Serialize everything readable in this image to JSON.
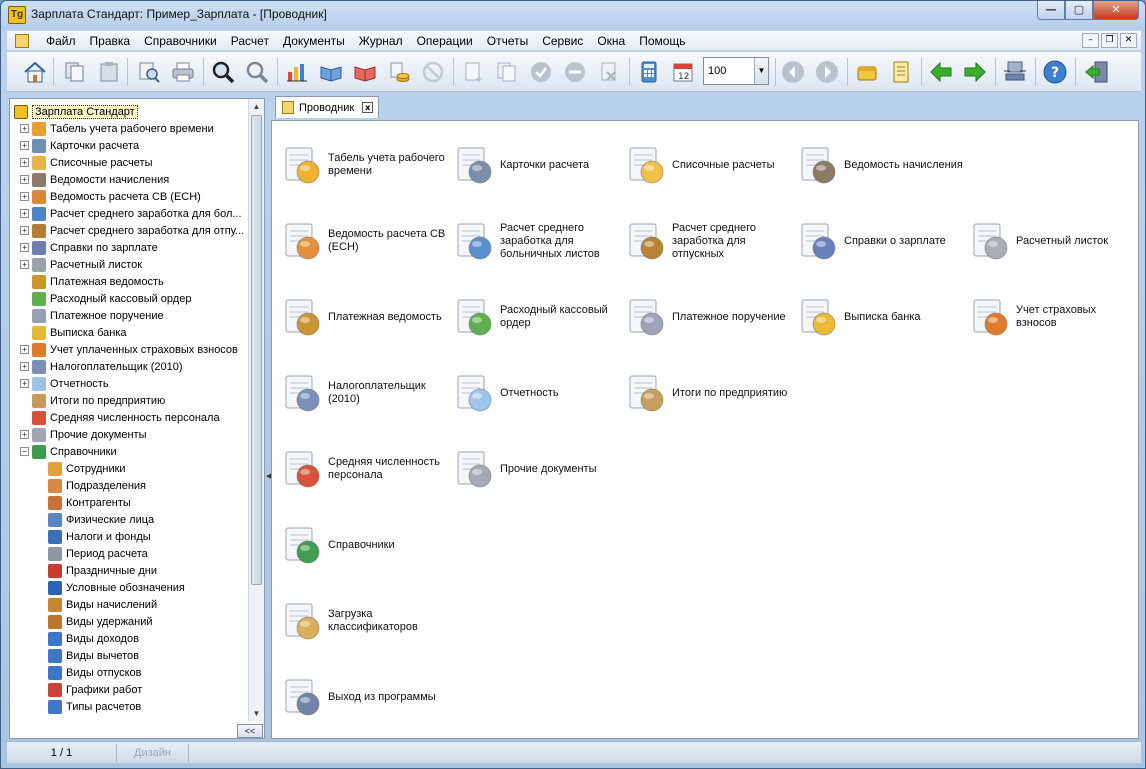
{
  "window": {
    "title": "Зарплата Стандарт: Пример_Зарплата - [Проводник]",
    "app_icon_text": "Tg",
    "controls": {
      "minimize": "—",
      "maximize": "▢",
      "close": "✕"
    }
  },
  "menu": {
    "items": [
      "Файл",
      "Правка",
      "Справочники",
      "Расчет",
      "Документы",
      "Журнал",
      "Операции",
      "Отчеты",
      "Сервис",
      "Окна",
      "Помощь"
    ],
    "mdi": {
      "minimize": "–",
      "restore": "❐",
      "close": "✕"
    }
  },
  "toolbar": {
    "zoom_value": "100",
    "dropdown_arrow": "▼"
  },
  "tree": {
    "root": "Зарплата Стандарт",
    "items": [
      {
        "label": "Табель учета рабочего времени",
        "exp": "+",
        "level": 0,
        "color": "#e8a030"
      },
      {
        "label": "Карточки расчета",
        "exp": "+",
        "level": 0,
        "color": "#6f8fb5"
      },
      {
        "label": "Списочные расчеты",
        "exp": "+",
        "level": 0,
        "color": "#e6b44a"
      },
      {
        "label": "Ведомости начисления",
        "exp": "+",
        "level": 0,
        "color": "#8c7b6a"
      },
      {
        "label": "Ведомость расчета СВ (ЕСН)",
        "exp": "+",
        "level": 0,
        "color": "#d9883a"
      },
      {
        "label": "Расчет среднего заработка для бол...",
        "exp": "+",
        "level": 0,
        "color": "#4f84c4"
      },
      {
        "label": "Расчет среднего заработка для отпу...",
        "exp": "+",
        "level": 0,
        "color": "#b07d35"
      },
      {
        "label": "Справки по зарплате",
        "exp": "+",
        "level": 0,
        "color": "#6a7fb0"
      },
      {
        "label": "Расчетный листок",
        "exp": "+",
        "level": 0,
        "color": "#9aa3ad"
      },
      {
        "label": "Платежная ведомость",
        "exp": "",
        "level": 0,
        "color": "#c9952d"
      },
      {
        "label": "Расходный кассовый ордер",
        "exp": "",
        "level": 0,
        "color": "#5fae4f"
      },
      {
        "label": "Платежное поручение",
        "exp": "",
        "level": 0,
        "color": "#9aa0b4"
      },
      {
        "label": "Выписка банка",
        "exp": "",
        "level": 0,
        "color": "#e6b933"
      },
      {
        "label": "Учет уплаченных страховых взносов",
        "exp": "+",
        "level": 0,
        "color": "#e07a2a"
      },
      {
        "label": "Налогоплательщик (2010)",
        "exp": "+",
        "level": 0,
        "color": "#7b8fb5"
      },
      {
        "label": "Отчетность",
        "exp": "+",
        "level": 0,
        "color": "#9ec1e6"
      },
      {
        "label": "Итоги по предприятию",
        "exp": "",
        "level": 0,
        "color": "#c89a5a"
      },
      {
        "label": "Средняя численность персонала",
        "exp": "",
        "level": 0,
        "color": "#d9503a"
      },
      {
        "label": "Прочие документы",
        "exp": "+",
        "level": 0,
        "color": "#a0a6b3"
      },
      {
        "label": "Справочники",
        "exp": "−",
        "level": 0,
        "color": "#3d9a4e"
      },
      {
        "label": "Сотрудники",
        "exp": "",
        "level": 1,
        "color": "#e2a137"
      },
      {
        "label": "Подразделения",
        "exp": "",
        "level": 1,
        "color": "#d78a3f"
      },
      {
        "label": "Контрагенты",
        "exp": "",
        "level": 1,
        "color": "#c9733a"
      },
      {
        "label": "Физические лица",
        "exp": "",
        "level": 1,
        "color": "#5a83c1"
      },
      {
        "label": "Налоги и фонды",
        "exp": "",
        "level": 1,
        "color": "#3c6fb3"
      },
      {
        "label": "Период расчета",
        "exp": "",
        "level": 1,
        "color": "#8d97a6"
      },
      {
        "label": "Праздничные дни",
        "exp": "",
        "level": 1,
        "color": "#c63c2e"
      },
      {
        "label": "Условные обозначения",
        "exp": "",
        "level": 1,
        "color": "#2b64b5"
      },
      {
        "label": "Виды начислений",
        "exp": "",
        "level": 1,
        "color": "#c5872f"
      },
      {
        "label": "Виды удержаний",
        "exp": "",
        "level": 1,
        "color": "#b9762a"
      },
      {
        "label": "Виды доходов",
        "exp": "",
        "level": 1,
        "color": "#3f76c7"
      },
      {
        "label": "Виды вычетов",
        "exp": "",
        "level": 1,
        "color": "#3f76c7"
      },
      {
        "label": "Виды отпусков",
        "exp": "",
        "level": 1,
        "color": "#3f76c7"
      },
      {
        "label": "Графики работ",
        "exp": "",
        "level": 1,
        "color": "#c94538"
      },
      {
        "label": "Типы расчетов",
        "exp": "",
        "level": 1,
        "color": "#3f76c7"
      }
    ],
    "collapse_label": "<<",
    "scroll_up": "▲",
    "scroll_down": "▼"
  },
  "tab": {
    "label": "Проводник",
    "close": "x"
  },
  "explorer": {
    "items": [
      {
        "id": "timesheet",
        "label": "Табель учета рабочего времени",
        "col": 0,
        "row": 0,
        "color": "#f0b030",
        "icon": "timesheet-icon"
      },
      {
        "id": "calc-cards",
        "label": "Карточки расчета",
        "col": 1,
        "row": 0,
        "color": "#7d8fa8",
        "icon": "calc-cards-icon"
      },
      {
        "id": "list-calc",
        "label": "Списочные расчеты",
        "col": 2,
        "row": 0,
        "color": "#f2c04a",
        "icon": "list-calc-icon"
      },
      {
        "id": "accrual-sheet",
        "label": "Ведомость начисления",
        "col": 3,
        "row": 0,
        "color": "#8a7a66",
        "icon": "accrual-sheet-icon"
      },
      {
        "id": "sv-sheet",
        "label": "Ведомость расчета СВ (ЕСН)",
        "col": 0,
        "row": 1,
        "color": "#e2903c",
        "icon": "sv-sheet-icon"
      },
      {
        "id": "sick-avg",
        "label": "Расчет среднего заработка для больничных листов",
        "col": 1,
        "row": 1,
        "color": "#5a8fd0",
        "icon": "sick-avg-icon"
      },
      {
        "id": "vacation-avg",
        "label": "Расчет среднего заработка для отпускных",
        "col": 2,
        "row": 1,
        "color": "#b98535",
        "icon": "vacation-avg-icon"
      },
      {
        "id": "salary-cert",
        "label": "Справки о зарплате",
        "col": 3,
        "row": 1,
        "color": "#6a80b8",
        "icon": "salary-cert-icon"
      },
      {
        "id": "payslip",
        "label": "Расчетный листок",
        "col": 4,
        "row": 1,
        "color": "#a7aeb8",
        "icon": "payslip-icon"
      },
      {
        "id": "pay-sheet",
        "label": "Платежная ведомость",
        "col": 0,
        "row": 2,
        "color": "#c99530",
        "icon": "money-bag-icon"
      },
      {
        "id": "cash-order",
        "label": "Расходный кассовый ордер",
        "col": 1,
        "row": 2,
        "color": "#5cb050",
        "icon": "cash-order-icon"
      },
      {
        "id": "pay-order",
        "label": "Платежное поручение",
        "col": 2,
        "row": 2,
        "color": "#9ea4b8",
        "icon": "pay-order-icon"
      },
      {
        "id": "bank-statement",
        "label": "Выписка банка",
        "col": 3,
        "row": 2,
        "color": "#e8ba35",
        "icon": "bank-statement-icon"
      },
      {
        "id": "insurance",
        "label": "Учет страховых взносов",
        "col": 4,
        "row": 2,
        "color": "#e27a2c",
        "icon": "insurance-icon"
      },
      {
        "id": "taxpayer",
        "label": "Налогоплательщик (2010)",
        "col": 0,
        "row": 3,
        "color": "#7b90b8",
        "icon": "taxpayer-icon"
      },
      {
        "id": "reporting",
        "label": "Отчетность",
        "col": 1,
        "row": 3,
        "color": "#9fc6ea",
        "icon": "reporting-icon"
      },
      {
        "id": "totals",
        "label": "Итоги по предприятию",
        "col": 2,
        "row": 3,
        "color": "#c99d5c",
        "icon": "totals-icon"
      },
      {
        "id": "headcount",
        "label": "Средняя численность персонала",
        "col": 0,
        "row": 4,
        "color": "#d8533b",
        "icon": "headcount-icon"
      },
      {
        "id": "other-docs",
        "label": "Прочие документы",
        "col": 1,
        "row": 4,
        "color": "#a4aab6",
        "icon": "other-docs-icon"
      },
      {
        "id": "refs",
        "label": "Справочники",
        "col": 0,
        "row": 5,
        "color": "#3f9c50",
        "icon": "books-icon"
      },
      {
        "id": "load-class",
        "label": "Загрузка классификаторов",
        "col": 0,
        "row": 6,
        "color": "#d8b05a",
        "icon": "download-box-icon"
      },
      {
        "id": "exit",
        "label": "Выход из программы",
        "col": 0,
        "row": 7,
        "color": "#7483a8",
        "icon": "exit-door-icon"
      }
    ]
  },
  "status": {
    "page": "1 / 1",
    "mode": "Дизайн"
  },
  "colors": {
    "accent": "#3d6fb0",
    "green_arrow": "#3cae2e",
    "nav_circle": "#b9c3d0"
  }
}
